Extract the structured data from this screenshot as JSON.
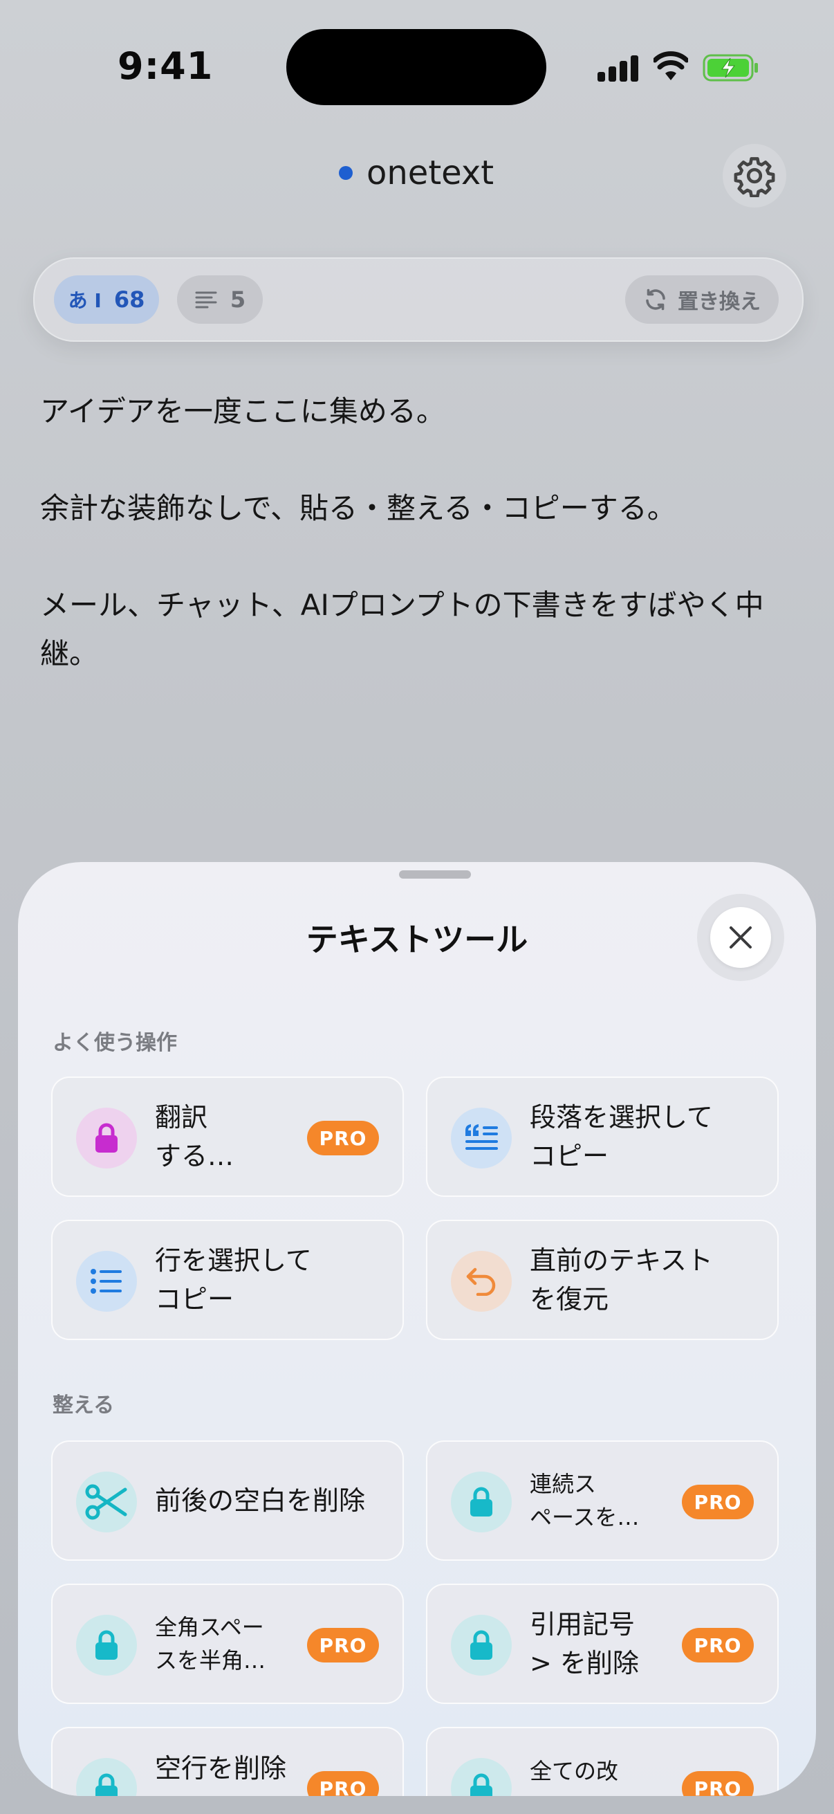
{
  "status_bar": {
    "time": "9:41"
  },
  "header": {
    "app_title": "onetext"
  },
  "toolbar": {
    "char_count_icon": "あ I",
    "char_count": "68",
    "line_count": "5",
    "replace_label": "置き換え"
  },
  "editor": {
    "paragraphs": [
      "アイデアを一度ここに集める。",
      "余計な装飾なしで、貼る・整える・コピーする。",
      "メール、チャット、AIプロンプトの下書きをすばやく中継。"
    ]
  },
  "sheet": {
    "title": "テキストツール",
    "sections": [
      {
        "label": "よく使う操作",
        "items": [
          {
            "label": "翻訳\nする…",
            "icon": "lock-icon",
            "pro": "PRO"
          },
          {
            "label": "段落を選択して\nコピー",
            "icon": "quote-paragraph-icon"
          },
          {
            "label": "行を選択して\nコピー",
            "icon": "list-icon"
          },
          {
            "label": "直前のテキスト\nを復元",
            "icon": "undo-arrow-icon"
          }
        ]
      },
      {
        "label": "整える",
        "items": [
          {
            "label": "前後の空白を削除",
            "icon": "scissors-icon"
          },
          {
            "label": "連続ス\nペースを…",
            "icon": "lock-icon",
            "pro": "PRO"
          },
          {
            "label": "全角スペー\nスを半角…",
            "icon": "lock-icon",
            "pro": "PRO"
          },
          {
            "label": "引用記号\n> を削除",
            "icon": "lock-icon",
            "pro": "PRO"
          },
          {
            "label": "空行を削除",
            "icon": "lock-icon",
            "pro": "PRO"
          },
          {
            "label": "全ての改",
            "icon": "lock-icon",
            "pro": "PRO"
          }
        ]
      }
    ]
  },
  "colors": {
    "accent_blue": "#1e5fd0",
    "pro_orange": "#f5872a",
    "lock_magenta": "#c72ccf",
    "lock_teal": "#17b9c9"
  }
}
